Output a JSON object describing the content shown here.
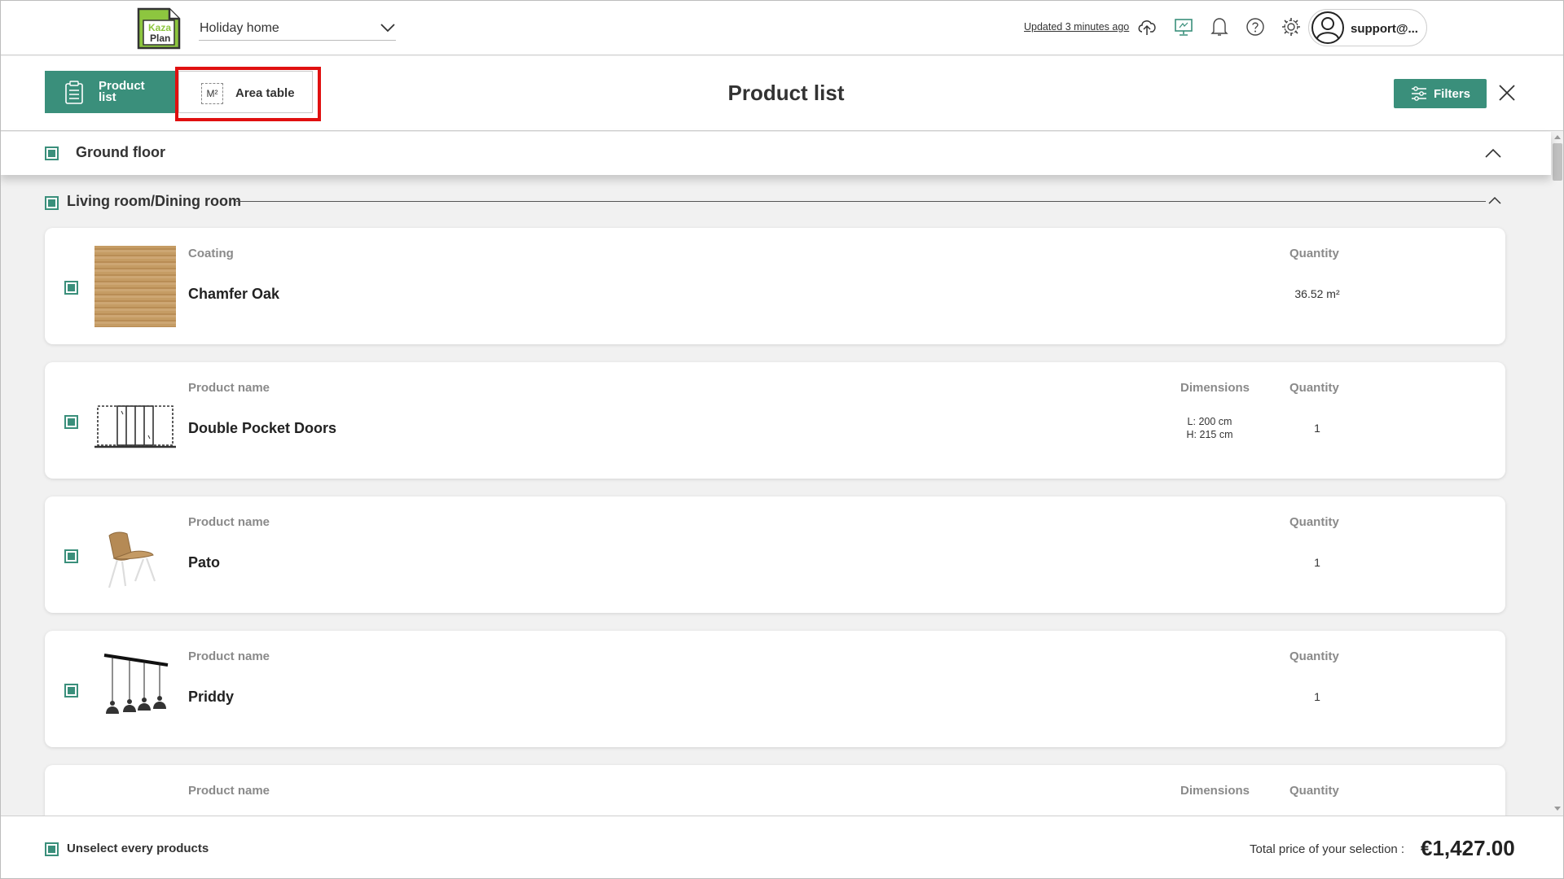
{
  "topbar": {
    "logo_text_1": "Kaza",
    "logo_text_2": "Plan",
    "project_name": "Holiday home",
    "updated_text": "Updated 3 minutes ago",
    "user_name": "support@...",
    "icons": [
      "cloud-upload-icon",
      "monitor-icon",
      "bell-icon",
      "help-icon",
      "gear-icon",
      "user-icon"
    ]
  },
  "header": {
    "tab_product_label": "Product list",
    "tab_area_icon": "M²",
    "tab_area_label": "Area table",
    "title": "Product list",
    "filters_label": "Filters"
  },
  "floor": {
    "name": "Ground floor"
  },
  "room": {
    "name": "Living room/Dining room"
  },
  "products": [
    {
      "type_label": "Coating",
      "name": "Chamfer Oak",
      "quantity_label": "Quantity",
      "quantity": "36.52 m²"
    },
    {
      "type_label": "Product name",
      "name": "Double Pocket Doors",
      "dimensions_label": "Dimensions",
      "dim_l": "L: 200 cm",
      "dim_h": "H: 215 cm",
      "quantity_label": "Quantity",
      "quantity": "1"
    },
    {
      "type_label": "Product name",
      "name": "Pato",
      "quantity_label": "Quantity",
      "quantity": "1"
    },
    {
      "type_label": "Product name",
      "name": "Priddy",
      "quantity_label": "Quantity",
      "quantity": "1"
    },
    {
      "type_label": "Product name",
      "dimensions_label": "Dimensions",
      "quantity_label": "Quantity"
    }
  ],
  "footer": {
    "unselect_label": "Unselect every products",
    "total_label": "Total price of your selection :",
    "total_value": "€1,427.00"
  },
  "colors": {
    "accent": "#3a8f7b",
    "logo_green": "#8dc63f",
    "highlight": "#e01010"
  }
}
